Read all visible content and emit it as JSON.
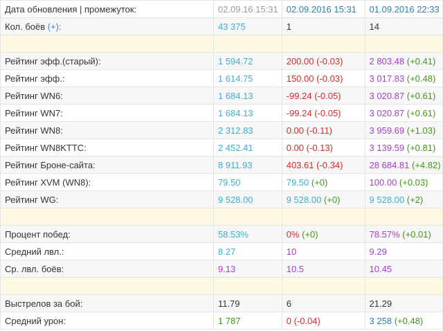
{
  "header": {
    "label": "Дата обновления | промежуток:",
    "col1": "02.09.16 15:31",
    "col2": "02.09.2016 15:31",
    "col3": "01.09.2016 22:33"
  },
  "battles": {
    "label": "Кол. боёв",
    "link": "(+):",
    "col1": "43 375",
    "col2": "1",
    "col3": "14"
  },
  "ratings": [
    {
      "label": "Рейтинг эфф.(старый):",
      "v1": "1 594.72",
      "v2": "200.00",
      "d2": "(-0.03)",
      "v3": "2 803.48",
      "d3": "(+0.41)"
    },
    {
      "label": "Рейтинг эфф.:",
      "v1": "1 614.75",
      "v2": "150.00",
      "d2": "(-0.03)",
      "v3": "3 017.83",
      "d3": "(+0.48)"
    },
    {
      "label": "Рейтинг WN6:",
      "v1": "1 684.13",
      "v2": "-99.24",
      "d2": "(-0.05)",
      "v3": "3 020.87",
      "d3": "(+0.61)"
    },
    {
      "label": "Рейтинг WN7:",
      "v1": "1 684.13",
      "v2": "-99.24",
      "d2": "(-0.05)",
      "v3": "3 020.87",
      "d3": "(+0.61)"
    },
    {
      "label": "Рейтинг WN8:",
      "v1": "2 312.83",
      "v2": "0.00",
      "d2": "(-0.11)",
      "v3": "3 959.69",
      "d3": "(+1.03)"
    },
    {
      "label": "Рейтинг WN8KTTC:",
      "v1": "2 452.41",
      "v2": "0.00",
      "d2": "(-0.13)",
      "v3": "3 139.59",
      "d3": "(+0.81)"
    },
    {
      "label": "Рейтинг Броне-сайта:",
      "v1": "8 911.93",
      "v2": "403.61",
      "d2": "(-0.34)",
      "v3": "28 684.81",
      "d3": "(+4.82)"
    },
    {
      "label": "Рейтинг XVM (WN8):",
      "v1": "79.50",
      "v2": "79.50",
      "d2": "(+0)",
      "v3": "100.00",
      "d3": "(+0.03)"
    },
    {
      "label": "Рейтинг WG:",
      "v1": "9 528.00",
      "v2": "9 528.00",
      "d2": "(+0)",
      "v3": "9 528.00",
      "d3": "(+2)"
    }
  ],
  "stats": {
    "winrate": {
      "label": "Процент побед:",
      "v1": "58.53%",
      "v2": "0%",
      "d2": "(+0)",
      "v3": "78.57%",
      "d3": "(+0.01)"
    },
    "avg_level": {
      "label": "Средний лвл.:",
      "v1": "8.27",
      "v2": "10",
      "v3": "9.29"
    },
    "avg_battle_level": {
      "label": "Ср. лвл. боёв:",
      "v1": "9.13",
      "v2": "10.5",
      "v3": "10.45"
    }
  },
  "combat": {
    "shots": {
      "label": "Выстрелов за бой:",
      "v1": "11.79",
      "v2": "6",
      "v3": "21.29"
    },
    "damage": {
      "label": "Средний урон:",
      "v1": "1 787",
      "v2": "0",
      "d2": "(-0.04)",
      "v3": "3 258",
      "d3": "(+0.48)"
    }
  },
  "colors": {
    "cyan": "#3aaecf",
    "red": "#d42a2a",
    "purple": "#a33fc4",
    "green": "#3c9a0e",
    "separator_row": "#fdf8e4",
    "alt_row": "#f7f7f7"
  }
}
